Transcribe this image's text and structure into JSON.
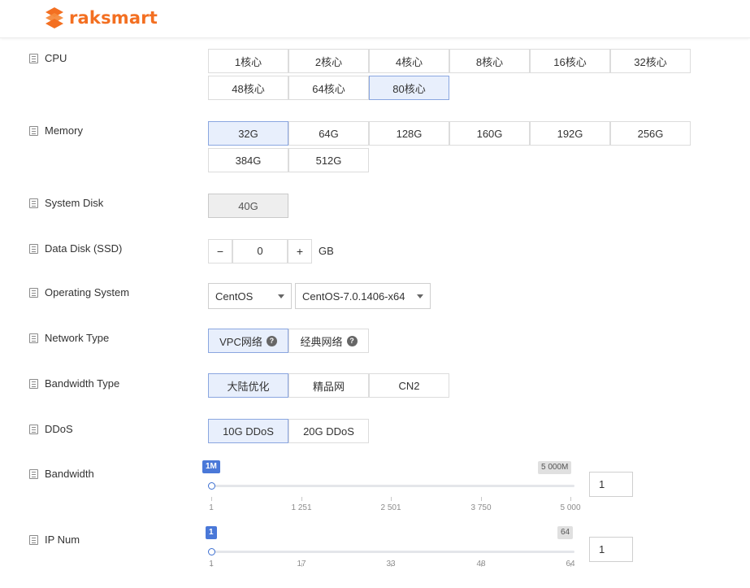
{
  "brand": {
    "name": "raksmart",
    "color": "#f36f21",
    "icon": "raksmart-logo-icon"
  },
  "accent": "#3c6fd1",
  "cpu": {
    "label": "CPU",
    "options": [
      "1核心",
      "2核心",
      "4核心",
      "8核心",
      "16核心",
      "32核心",
      "48核心",
      "64核心",
      "80核心"
    ],
    "selected": "80核心"
  },
  "memory": {
    "label": "Memory",
    "options": [
      "32G",
      "64G",
      "128G",
      "160G",
      "192G",
      "256G",
      "384G",
      "512G"
    ],
    "selected": "32G"
  },
  "system_disk": {
    "label": "System Disk",
    "value": "40G"
  },
  "data_disk": {
    "label": "Data Disk (SSD)",
    "minus": "−",
    "plus": "+",
    "value": "0",
    "unit": "GB"
  },
  "os": {
    "label": "Operating System",
    "family": "CentOS",
    "version": "CentOS-7.0.1406-x64"
  },
  "network_type": {
    "label": "Network Type",
    "options": [
      "VPC网络",
      "经典网络"
    ],
    "selected": "VPC网络",
    "help_icon": "question-circle-icon"
  },
  "bandwidth_type": {
    "label": "Bandwidth Type",
    "options": [
      "大陆优化",
      "精品网",
      "CN2"
    ],
    "selected": "大陆优化"
  },
  "ddos": {
    "label": "DDoS",
    "options": [
      "10G DDoS",
      "20G DDoS"
    ],
    "selected": "10G DDoS"
  },
  "bandwidth": {
    "label": "Bandwidth",
    "min_badge": "1M",
    "max_badge": "5 000M",
    "ticks": [
      "1",
      "1 251",
      "2 501",
      "3 750",
      "5 000"
    ],
    "value": "1",
    "fraction": 0
  },
  "ip_num": {
    "label": "IP Num",
    "min_badge": "1",
    "max_badge": "64",
    "ticks": [
      "1",
      "17",
      "33",
      "48",
      "64"
    ],
    "value": "1",
    "fraction": 0
  }
}
